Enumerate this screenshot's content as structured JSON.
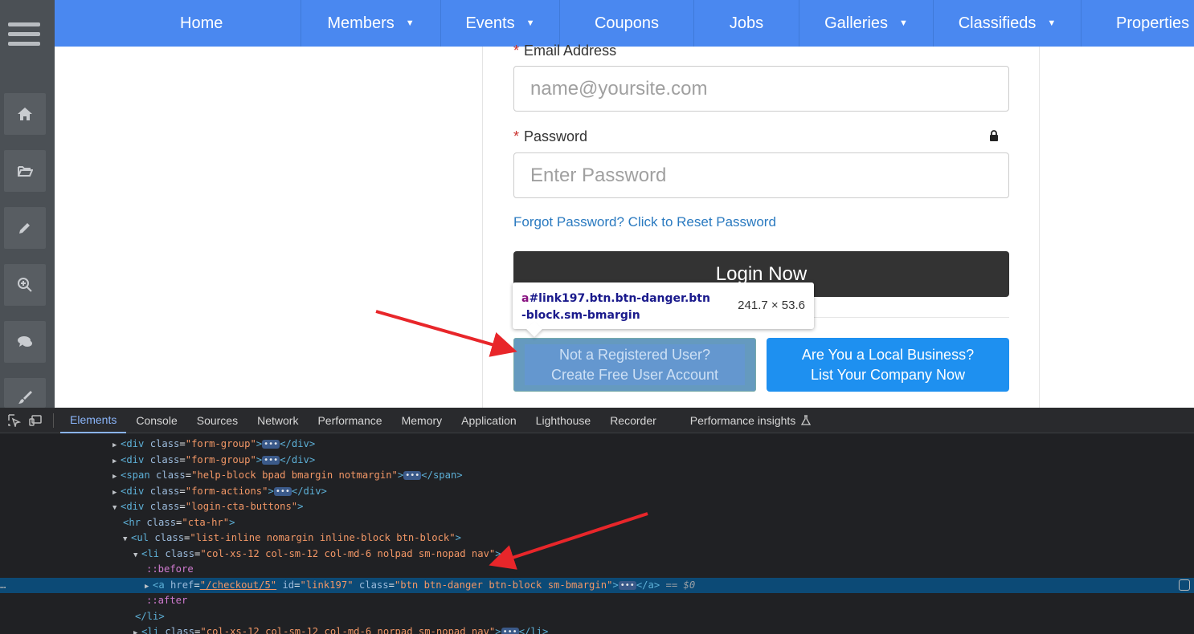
{
  "topnav": {
    "items": [
      {
        "label": "Home",
        "dropdown": false
      },
      {
        "label": "Members",
        "dropdown": true
      },
      {
        "label": "Events",
        "dropdown": true
      },
      {
        "label": "Coupons",
        "dropdown": false
      },
      {
        "label": "Jobs",
        "dropdown": false
      },
      {
        "label": "Galleries",
        "dropdown": true
      },
      {
        "label": "Classifieds",
        "dropdown": true
      },
      {
        "label": "Properties",
        "dropdown": false
      }
    ],
    "caret": "▼"
  },
  "sidebar": {
    "icons": [
      "menu-icon",
      "home-icon",
      "folder-open-icon",
      "pencil-icon",
      "zoom-in-icon",
      "comments-icon",
      "paintbrush-icon"
    ]
  },
  "login": {
    "required_mark": "*",
    "email_label": "Email Address",
    "email_placeholder": "name@yoursite.com",
    "password_label": "Password",
    "password_placeholder": "Enter Password",
    "forgot_link": "Forgot Password? Click to Reset Password",
    "login_button": "Login Now",
    "cta_left_line1": "Not a Registered User?",
    "cta_left_line2": "Create Free User Account",
    "cta_right_line1": "Are You a Local Business?",
    "cta_right_line2": "List Your Company Now"
  },
  "tooltip": {
    "tag": "a",
    "selector": "#link197.btn.btn-danger.btn-block.sm-bmargin",
    "dimensions": "241.7 × 53.6"
  },
  "devtools": {
    "tabs": [
      "Elements",
      "Console",
      "Sources",
      "Network",
      "Performance",
      "Memory",
      "Application",
      "Lighthouse",
      "Recorder",
      "Performance insights"
    ],
    "active_tab": "Elements",
    "lines": [
      {
        "tri": "▶",
        "tag": "div",
        "attrs": [
          [
            "class",
            "form-group"
          ]
        ],
        "ellipsis": true,
        "close": "</div>"
      },
      {
        "tri": "▶",
        "tag": "div",
        "attrs": [
          [
            "class",
            "form-group"
          ]
        ],
        "ellipsis": true,
        "close": "</div>"
      },
      {
        "tri": "▶",
        "tag": "span",
        "attrs": [
          [
            "class",
            "help-block bpad bmargin notmargin"
          ]
        ],
        "ellipsis": true,
        "close": "</span>"
      },
      {
        "tri": "▶",
        "tag": "div",
        "attrs": [
          [
            "class",
            "form-actions"
          ]
        ],
        "ellipsis": true,
        "close": "</div>"
      },
      {
        "tri": "▼",
        "tag": "div",
        "attrs": [
          [
            "class",
            "login-cta-buttons"
          ]
        ],
        "ellipsis": false,
        "close": ""
      },
      {
        "tri": "",
        "tag": "hr",
        "attrs": [
          [
            "class",
            "cta-hr"
          ]
        ],
        "ellipsis": false,
        "close": ""
      },
      {
        "tri": "▼",
        "tag": "ul",
        "attrs": [
          [
            "class",
            "list-inline nomargin inline-block btn-block"
          ]
        ],
        "ellipsis": false,
        "close": ""
      },
      {
        "tri": "▼",
        "tag": "li",
        "attrs": [
          [
            "class",
            "col-xs-12 col-sm-12 col-md-6 nolpad sm-nopad nav"
          ]
        ],
        "ellipsis": false,
        "close": ""
      },
      {
        "pseudo": "::before"
      },
      {
        "tri": "▶",
        "tag": "a",
        "attrs": [
          [
            "href",
            "/checkout/5"
          ],
          [
            "id",
            "link197"
          ],
          [
            "class",
            "btn btn-danger btn-block sm-bmargin"
          ]
        ],
        "ellipsis": true,
        "close": "</a>",
        "suffix": "== $0",
        "selected": true
      },
      {
        "pseudo": "::after"
      },
      {
        "closing": "</li>"
      },
      {
        "tri": "▶",
        "tag": "li",
        "attrs": [
          [
            "class",
            "col-xs-12 col-sm-12 col-md-6 norpad sm-nopad nav"
          ]
        ],
        "ellipsis": true,
        "close": "</li>"
      }
    ],
    "row_menu": "…"
  },
  "colors": {
    "nav_blue": "#4a88f0",
    "login_dark": "#333333",
    "cta_blue": "#1e90f0",
    "link_blue": "#2a7ac0",
    "required_red": "#c9302c",
    "arrow_red": "#e8262a"
  }
}
